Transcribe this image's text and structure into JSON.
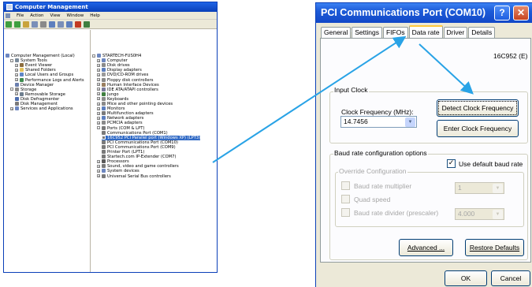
{
  "cm": {
    "title": "Computer Management",
    "menu": [
      "File",
      "Action",
      "View",
      "Window",
      "Help"
    ],
    "left_tree": [
      {
        "label": "Computer Management (Local)",
        "indent": 0,
        "color": "#6d87c0"
      },
      {
        "label": "System Tools",
        "indent": 1,
        "color": "#7a8a9a",
        "pm": "-"
      },
      {
        "label": "Event Viewer",
        "indent": 2,
        "color": "#8c6d3f",
        "pm": "+"
      },
      {
        "label": "Shared Folders",
        "indent": 2,
        "color": "#e3c25a",
        "pm": "+"
      },
      {
        "label": "Local Users and Groups",
        "indent": 2,
        "color": "#5f86c6",
        "pm": "+"
      },
      {
        "label": "Performance Logs and Alerts",
        "indent": 2,
        "color": "#3f8c4f",
        "pm": "+"
      },
      {
        "label": "Device Manager",
        "indent": 2,
        "color": "#6a7fae",
        "sel": false
      },
      {
        "label": "Storage",
        "indent": 1,
        "color": "#8a8a8a",
        "pm": "-"
      },
      {
        "label": "Removable Storage",
        "indent": 2,
        "color": "#6f7f8f",
        "pm": "+"
      },
      {
        "label": "Disk Defragmenter",
        "indent": 2,
        "color": "#4e6fb0"
      },
      {
        "label": "Disk Management",
        "indent": 2,
        "color": "#7a7a7a"
      },
      {
        "label": "Services and Applications",
        "indent": 1,
        "color": "#6d87c0",
        "pm": "+"
      }
    ],
    "right_tree": [
      {
        "label": "STARTECH-FUS0H4",
        "indent": 0,
        "color": "#6d87c0",
        "pm": "-"
      },
      {
        "label": "Computer",
        "indent": 1,
        "color": "#6d87c0",
        "pm": "+"
      },
      {
        "label": "Disk drives",
        "indent": 1,
        "color": "#8a8a8a",
        "pm": "+"
      },
      {
        "label": "Display adapters",
        "indent": 1,
        "color": "#5d7fbe",
        "pm": "+"
      },
      {
        "label": "DVD/CD-ROM drives",
        "indent": 1,
        "color": "#9a9a9a",
        "pm": "+"
      },
      {
        "label": "Floppy disk controllers",
        "indent": 1,
        "color": "#8a8a8a",
        "pm": "+"
      },
      {
        "label": "Human Interface Devices",
        "indent": 1,
        "color": "#9a7f5f",
        "pm": "+"
      },
      {
        "label": "IDE ATA/ATAPI controllers",
        "indent": 1,
        "color": "#7a7a9a",
        "pm": "+"
      },
      {
        "label": "Jungo",
        "indent": 1,
        "color": "#3f7f3f",
        "pm": "+"
      },
      {
        "label": "Keyboards",
        "indent": 1,
        "color": "#8a8a8a",
        "pm": "+"
      },
      {
        "label": "Mice and other pointing devices",
        "indent": 1,
        "color": "#8a8a8a",
        "pm": "+"
      },
      {
        "label": "Monitors",
        "indent": 1,
        "color": "#5d7fbe",
        "pm": "+"
      },
      {
        "label": "Multifunction adapters",
        "indent": 1,
        "color": "#7a7a7a",
        "pm": "+"
      },
      {
        "label": "Network adapters",
        "indent": 1,
        "color": "#5d7fbe",
        "pm": "+"
      },
      {
        "label": "PCMCIA adapters",
        "indent": 1,
        "color": "#8a8a8a",
        "pm": "+"
      },
      {
        "label": "Ports (COM & LPT)",
        "indent": 1,
        "color": "#7a7a7a",
        "pm": "-"
      },
      {
        "label": "Communications Port (COM1)",
        "indent": 2,
        "color": "#7a7a7a"
      },
      {
        "label": "16C952 PCI Parallel port (Windows XP) (LPT3)",
        "indent": 2,
        "color": "#7a7a7a",
        "sel": true
      },
      {
        "label": "PCI Communications Port (COM10)",
        "indent": 2,
        "color": "#7a7a7a"
      },
      {
        "label": "PCI Communications Port (COM9)",
        "indent": 2,
        "color": "#7a7a7a"
      },
      {
        "label": "Printer Port (LPT1)",
        "indent": 2,
        "color": "#7a7a7a"
      },
      {
        "label": "Startech.com IP-Extender (COM7)",
        "indent": 2,
        "color": "#7a7a7a"
      },
      {
        "label": "Processors",
        "indent": 1,
        "color": "#5a5a5a",
        "pm": "+"
      },
      {
        "label": "Sound, video and game controllers",
        "indent": 1,
        "color": "#7a7a7a",
        "pm": "+"
      },
      {
        "label": "System devices",
        "indent": 1,
        "color": "#6d87c0",
        "pm": "+"
      },
      {
        "label": "Universal Serial Bus controllers",
        "indent": 1,
        "color": "#7a7a7a",
        "pm": "+"
      }
    ]
  },
  "dialog": {
    "title": "PCI Communications Port (COM10) Properties",
    "tabs": [
      "General",
      "Settings",
      "FIFOs",
      "Data rate",
      "Driver",
      "Details"
    ],
    "active_tab": "Data rate",
    "device_type": "16C952 (E)",
    "input_clock_label": "Input Clock",
    "clock_freq_label": "Clock Frequency (MHz):",
    "clock_freq_value": "14.7456",
    "detect_button": "Detect Clock Frequency",
    "enter_button": "Enter Clock Frequency",
    "baud_group_label": "Baud rate configuration options",
    "use_default_label": "Use default baud rate",
    "use_default_checked": true,
    "override_label": "Override Configuration",
    "multiplier_label": "Baud rate multiplier",
    "multiplier_value": "1",
    "quad_label": "Quad speed",
    "divider_label": "Baud rate divider (prescaler)",
    "divider_value": "4.000",
    "advanced_button": "Advanced ...",
    "restore_button": "Restore Defaults",
    "ok_button": "OK",
    "cancel_button": "Cancel"
  },
  "colors": {
    "arrow": "#29a3e6",
    "xp_blue": "#0a3fb8",
    "selection": "#316ac5"
  }
}
